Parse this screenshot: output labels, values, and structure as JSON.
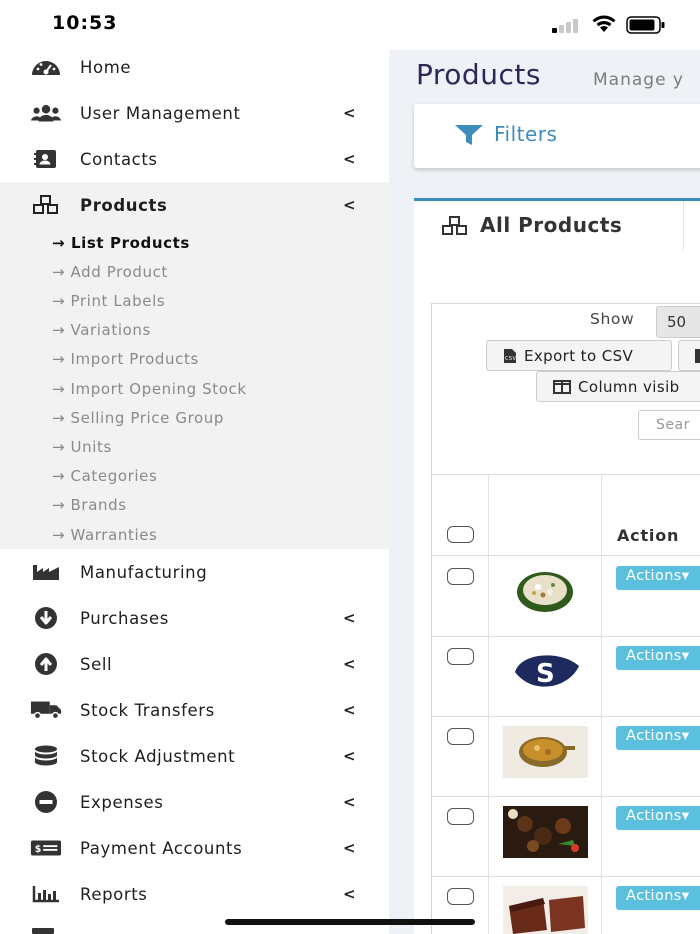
{
  "status_bar": {
    "time": "10:53"
  },
  "sidebar": {
    "items": [
      {
        "label": "Home",
        "icon": "dashboard-icon",
        "has_chevron": false
      },
      {
        "label": "User Management",
        "icon": "users-icon",
        "has_chevron": true
      },
      {
        "label": "Contacts",
        "icon": "address-book-icon",
        "has_chevron": true
      },
      {
        "label": "Products",
        "icon": "cubes-icon",
        "has_chevron": true,
        "active": true
      },
      {
        "label": "Manufacturing",
        "icon": "industry-icon",
        "has_chevron": false
      },
      {
        "label": "Purchases",
        "icon": "arrow-circle-down-icon",
        "has_chevron": true
      },
      {
        "label": "Sell",
        "icon": "arrow-circle-up-icon",
        "has_chevron": true
      },
      {
        "label": "Stock Transfers",
        "icon": "truck-icon",
        "has_chevron": true
      },
      {
        "label": "Stock Adjustment",
        "icon": "database-icon",
        "has_chevron": true
      },
      {
        "label": "Expenses",
        "icon": "minus-circle-icon",
        "has_chevron": true
      },
      {
        "label": "Payment Accounts",
        "icon": "money-check-icon",
        "has_chevron": true
      },
      {
        "label": "Reports",
        "icon": "bar-chart-icon",
        "has_chevron": true
      }
    ],
    "chevron": "<",
    "submenu": [
      {
        "label": "→ List Products",
        "current": true
      },
      {
        "label": "→ Add Product"
      },
      {
        "label": "→ Print Labels"
      },
      {
        "label": "→ Variations"
      },
      {
        "label": "→ Import Products"
      },
      {
        "label": "→ Import Opening Stock"
      },
      {
        "label": "→ Selling Price Group"
      },
      {
        "label": "→ Units"
      },
      {
        "label": "→ Categories"
      },
      {
        "label": "→ Brands"
      },
      {
        "label": "→ Warranties"
      }
    ]
  },
  "main": {
    "title": "Products",
    "subtitle": "Manage y",
    "filters_label": "Filters",
    "tab_label": "All Products",
    "show_label": "Show",
    "show_value": "50",
    "export_csv_label": "Export to CSV",
    "column_visibility_label": "Column visib",
    "search_placeholder": "Sear",
    "table": {
      "header_action": "Action",
      "rows": [
        {
          "image": "food-plate-image",
          "action_label": "Actions▾"
        },
        {
          "image": "brand-logo-image",
          "action_label": "Actions▾"
        },
        {
          "image": "curry-bowl-image",
          "action_label": "Actions▾"
        },
        {
          "image": "meat-dish-image",
          "action_label": "Actions▾"
        },
        {
          "image": "dessert-image",
          "action_label": "Actions▾"
        }
      ]
    }
  },
  "colors": {
    "accent": "#3c8dbc",
    "actions_button": "#5bc0de",
    "sidebar_active_bg": "#f2f2f2",
    "content_bg": "#eef1f6"
  }
}
